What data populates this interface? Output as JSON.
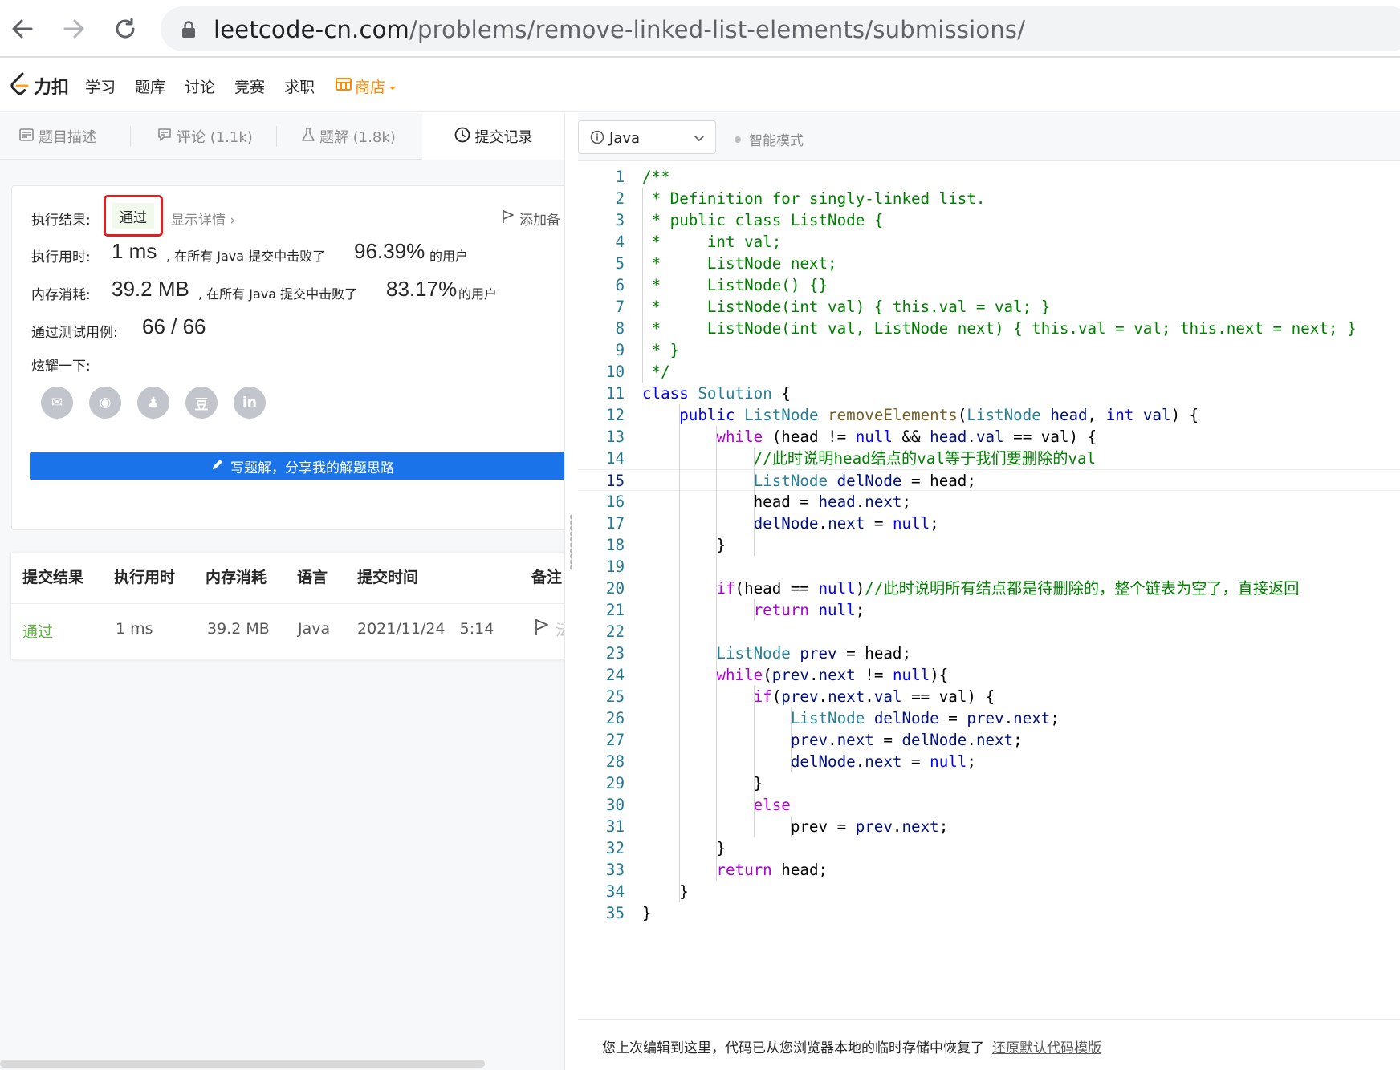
{
  "browser": {
    "url_host": "leetcode-cn.com",
    "url_path": "/problems/remove-linked-list-elements/submissions/"
  },
  "header": {
    "logo_text": "力扣",
    "nav": [
      "学习",
      "题库",
      "讨论",
      "竞赛",
      "求职"
    ],
    "store_label": "商店"
  },
  "tabs": [
    {
      "label": "题目描述",
      "icon": "description-icon"
    },
    {
      "label": "评论 (1.1k)",
      "icon": "comment-icon"
    },
    {
      "label": "题解 (1.8k)",
      "icon": "flask-icon"
    },
    {
      "label": "提交记录",
      "icon": "clock-icon"
    }
  ],
  "result": {
    "exec_result_label": "执行结果:",
    "status": "通过",
    "detail_link": "显示详情 ›",
    "add_note": "添加备",
    "runtime_label": "执行用时:",
    "runtime_value": "1 ms",
    "runtime_mid": ", 在所有 Java 提交中击败了",
    "runtime_pct": "96.39%",
    "runtime_tail": "的用户",
    "memory_label": "内存消耗:",
    "memory_value": "39.2 MB",
    "memory_mid": ", 在所有 Java 提交中击败了",
    "memory_pct": "83.17%",
    "memory_tail": "的用户",
    "tests_label": "通过测试用例:",
    "tests_value": "66  /  66",
    "share_label": "炫耀一下:",
    "share_icons": [
      "wechat-icon",
      "weibo-icon",
      "qq-icon",
      "douban-icon",
      "linkedin-icon"
    ],
    "share_glyphs": [
      "✉",
      "◉",
      "♟",
      "豆",
      "in"
    ],
    "write_button": "写题解，分享我的解题思路"
  },
  "submissions": {
    "headers": [
      "提交结果",
      "执行用时",
      "内存消耗",
      "语言",
      "提交时间",
      "备注"
    ],
    "rows": [
      {
        "result": "通过",
        "runtime": "1 ms",
        "memory": "39.2 MB",
        "language": "Java",
        "time": "2021/11/24   5:14",
        "note_cut": "沄"
      }
    ]
  },
  "editor": {
    "language": "Java",
    "mode": "智能模式",
    "current_line": 15,
    "restore_text": "您上次编辑到这里，代码已从您浏览器本地的临时存储中恢复了",
    "restore_link": "还原默认代码模版",
    "lines": [
      [
        [
          "com",
          "/**"
        ]
      ],
      [
        [
          "com",
          " * Definition for singly-linked list."
        ]
      ],
      [
        [
          "com",
          " * public class ListNode {"
        ]
      ],
      [
        [
          "com",
          " *     int val;"
        ]
      ],
      [
        [
          "com",
          " *     ListNode next;"
        ]
      ],
      [
        [
          "com",
          " *     ListNode() {}"
        ]
      ],
      [
        [
          "com",
          " *     ListNode(int val) { this.val = val; }"
        ]
      ],
      [
        [
          "com",
          " *     ListNode(int val, ListNode next) { this.val = val; this.next = next; }"
        ]
      ],
      [
        [
          "com",
          " * }"
        ]
      ],
      [
        [
          "com",
          " */"
        ]
      ],
      [
        [
          "kb",
          "class"
        ],
        [
          "pl",
          " "
        ],
        [
          "ty",
          "Solution"
        ],
        [
          "pl",
          " {"
        ]
      ],
      [
        [
          "pl",
          "    "
        ],
        [
          "kb",
          "public"
        ],
        [
          "pl",
          " "
        ],
        [
          "ty",
          "ListNode"
        ],
        [
          "pl",
          " "
        ],
        [
          "fn",
          "removeElements"
        ],
        [
          "pl",
          "("
        ],
        [
          "ty",
          "ListNode"
        ],
        [
          "pl",
          " "
        ],
        [
          "var",
          "head"
        ],
        [
          "pl",
          ", "
        ],
        [
          "kb",
          "int"
        ],
        [
          "pl",
          " "
        ],
        [
          "var",
          "val"
        ],
        [
          "pl",
          ") {"
        ]
      ],
      [
        [
          "pl",
          "        "
        ],
        [
          "kw",
          "while"
        ],
        [
          "pl",
          " (head != "
        ],
        [
          "kb",
          "null"
        ],
        [
          "pl",
          " && "
        ],
        [
          "var",
          "head"
        ],
        [
          "pl",
          "."
        ],
        [
          "var",
          "val"
        ],
        [
          "pl",
          " == val) {"
        ]
      ],
      [
        [
          "pl",
          "            "
        ],
        [
          "com",
          "//此时说明head结点的val等于我们要删除的val"
        ]
      ],
      [
        [
          "pl",
          "            "
        ],
        [
          "ty",
          "ListNode"
        ],
        [
          "pl",
          " "
        ],
        [
          "var",
          "delNode"
        ],
        [
          "pl",
          " = head;"
        ]
      ],
      [
        [
          "pl",
          "            head = "
        ],
        [
          "var",
          "head"
        ],
        [
          "pl",
          "."
        ],
        [
          "var",
          "next"
        ],
        [
          "pl",
          ";"
        ]
      ],
      [
        [
          "pl",
          "            "
        ],
        [
          "var",
          "delNode"
        ],
        [
          "pl",
          "."
        ],
        [
          "var",
          "next"
        ],
        [
          "pl",
          " = "
        ],
        [
          "kb",
          "null"
        ],
        [
          "pl",
          ";"
        ]
      ],
      [
        [
          "pl",
          "        }"
        ]
      ],
      [
        [
          "pl",
          ""
        ]
      ],
      [
        [
          "pl",
          "        "
        ],
        [
          "kw",
          "if"
        ],
        [
          "pl",
          "(head == "
        ],
        [
          "kb",
          "null"
        ],
        [
          "pl",
          ")"
        ],
        [
          "com",
          "//此时说明所有结点都是待删除的，整个链表为空了，直接返回"
        ]
      ],
      [
        [
          "pl",
          "            "
        ],
        [
          "kw",
          "return"
        ],
        [
          "pl",
          " "
        ],
        [
          "kb",
          "null"
        ],
        [
          "pl",
          ";"
        ]
      ],
      [
        [
          "pl",
          ""
        ]
      ],
      [
        [
          "pl",
          "        "
        ],
        [
          "ty",
          "ListNode"
        ],
        [
          "pl",
          " "
        ],
        [
          "var",
          "prev"
        ],
        [
          "pl",
          " = head;"
        ]
      ],
      [
        [
          "pl",
          "        "
        ],
        [
          "kw",
          "while"
        ],
        [
          "pl",
          "("
        ],
        [
          "var",
          "prev"
        ],
        [
          "pl",
          "."
        ],
        [
          "var",
          "next"
        ],
        [
          "pl",
          " != "
        ],
        [
          "kb",
          "null"
        ],
        [
          "pl",
          "){"
        ]
      ],
      [
        [
          "pl",
          "            "
        ],
        [
          "kw",
          "if"
        ],
        [
          "pl",
          "("
        ],
        [
          "var",
          "prev"
        ],
        [
          "pl",
          "."
        ],
        [
          "var",
          "next"
        ],
        [
          "pl",
          "."
        ],
        [
          "var",
          "val"
        ],
        [
          "pl",
          " == val) {"
        ]
      ],
      [
        [
          "pl",
          "                "
        ],
        [
          "ty",
          "ListNode"
        ],
        [
          "pl",
          " "
        ],
        [
          "var",
          "delNode"
        ],
        [
          "pl",
          " = "
        ],
        [
          "var",
          "prev"
        ],
        [
          "pl",
          "."
        ],
        [
          "var",
          "next"
        ],
        [
          "pl",
          ";"
        ]
      ],
      [
        [
          "pl",
          "                "
        ],
        [
          "var",
          "prev"
        ],
        [
          "pl",
          "."
        ],
        [
          "var",
          "next"
        ],
        [
          "pl",
          " = "
        ],
        [
          "var",
          "delNode"
        ],
        [
          "pl",
          "."
        ],
        [
          "var",
          "next"
        ],
        [
          "pl",
          ";"
        ]
      ],
      [
        [
          "pl",
          "                "
        ],
        [
          "var",
          "delNode"
        ],
        [
          "pl",
          "."
        ],
        [
          "var",
          "next"
        ],
        [
          "pl",
          " = "
        ],
        [
          "kb",
          "null"
        ],
        [
          "pl",
          ";"
        ]
      ],
      [
        [
          "pl",
          "            }"
        ]
      ],
      [
        [
          "pl",
          "            "
        ],
        [
          "kw",
          "else"
        ]
      ],
      [
        [
          "pl",
          "                prev = "
        ],
        [
          "var",
          "prev"
        ],
        [
          "pl",
          "."
        ],
        [
          "var",
          "next"
        ],
        [
          "pl",
          ";"
        ]
      ],
      [
        [
          "pl",
          "        }"
        ]
      ],
      [
        [
          "pl",
          "        "
        ],
        [
          "kw",
          "return"
        ],
        [
          "pl",
          " head;"
        ]
      ],
      [
        [
          "pl",
          "    }"
        ]
      ],
      [
        [
          "pl",
          "}"
        ]
      ]
    ]
  }
}
